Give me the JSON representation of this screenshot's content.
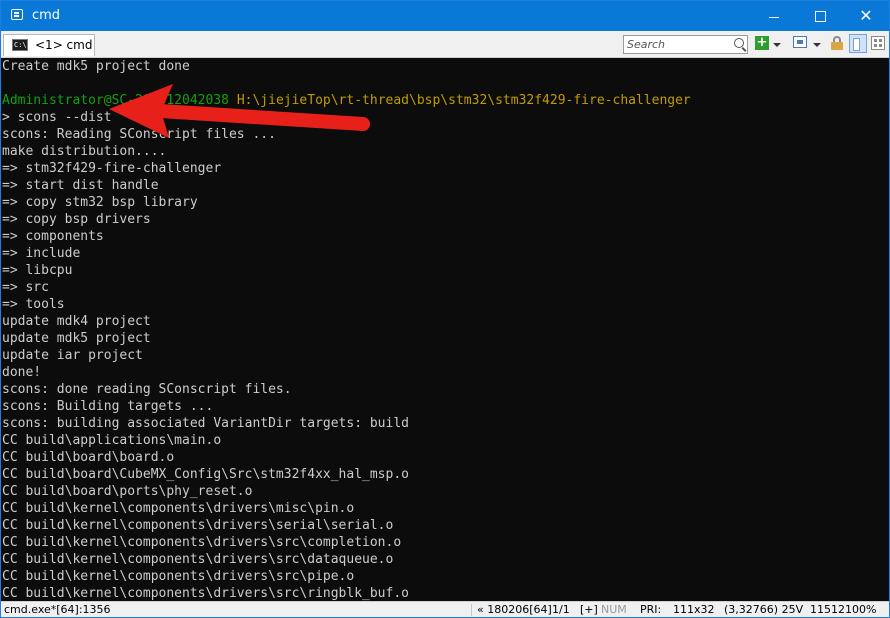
{
  "window": {
    "title": "cmd",
    "minimize_glyph": "",
    "maximize_glyph": "",
    "close_glyph": "✕"
  },
  "toolbar": {
    "tab_label": "<1> cmd",
    "tab_icon_text": "C:\\",
    "search_placeholder": "Search",
    "add_glyph": "+"
  },
  "console": {
    "lines": [
      {
        "text": "Create mdk5 project done"
      },
      {
        "text": ""
      },
      {
        "prompt_user": "Administrator@SC-201812042038",
        "prompt_path": "H:\\jiejieTop\\rt-thread\\bsp\\stm32\\stm32f429-fire-challenger"
      },
      {
        "text": "> scons --dist"
      },
      {
        "text": "scons: Reading SConscript files ..."
      },
      {
        "text": "make distribution...."
      },
      {
        "text": "=> stm32f429-fire-challenger"
      },
      {
        "text": "=> start dist handle"
      },
      {
        "text": "=> copy stm32 bsp library"
      },
      {
        "text": "=> copy bsp drivers"
      },
      {
        "text": "=> components"
      },
      {
        "text": "=> include"
      },
      {
        "text": "=> libcpu"
      },
      {
        "text": "=> src"
      },
      {
        "text": "=> tools"
      },
      {
        "text": "update mdk4 project"
      },
      {
        "text": "update mdk5 project"
      },
      {
        "text": "update iar project"
      },
      {
        "text": "done!"
      },
      {
        "text": "scons: done reading SConscript files."
      },
      {
        "text": "scons: Building targets ..."
      },
      {
        "text": "scons: building associated VariantDir targets: build"
      },
      {
        "text": "CC build\\applications\\main.o"
      },
      {
        "text": "CC build\\board\\board.o"
      },
      {
        "text": "CC build\\board\\CubeMX_Config\\Src\\stm32f4xx_hal_msp.o"
      },
      {
        "text": "CC build\\board\\ports\\phy_reset.o"
      },
      {
        "text": "CC build\\kernel\\components\\drivers\\misc\\pin.o"
      },
      {
        "text": "CC build\\kernel\\components\\drivers\\serial\\serial.o"
      },
      {
        "text": "CC build\\kernel\\components\\drivers\\src\\completion.o"
      },
      {
        "text": "CC build\\kernel\\components\\drivers\\src\\dataqueue.o"
      },
      {
        "text": "CC build\\kernel\\components\\drivers\\src\\pipe.o"
      },
      {
        "text": "CC build\\kernel\\components\\drivers\\src\\ringblk_buf.o"
      }
    ]
  },
  "statusbar": {
    "process": "cmd.exe*[64]:1356",
    "position": "« 180206[64]",
    "page": "1/1",
    "plus": "[+]",
    "num": "NUM",
    "pri": "PRI:",
    "size": "111x32",
    "coords": "(3,32766) 25V",
    "count": "11512",
    "zoom": "100%"
  },
  "colors": {
    "titlebar": "#0a78d7",
    "console_bg": "#0c0c0c",
    "console_text": "#cccccc",
    "prompt_user": "#13a10e",
    "prompt_path": "#c19c00",
    "annotation_arrow": "#e8201a"
  },
  "annotation": {
    "type": "arrow",
    "points_to": "scons --dist command"
  }
}
